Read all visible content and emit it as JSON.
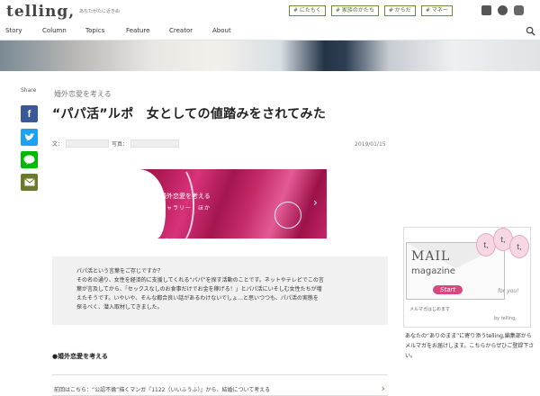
{
  "header": {
    "logo": "telling,",
    "tagline": "あなたがたに近きぬ",
    "tags": [
      "# にたもく",
      "# 家族のかたち",
      "# からだ",
      "# マネー"
    ]
  },
  "nav": {
    "items": [
      "Story",
      "Column",
      "Topics",
      "Feature",
      "Creator",
      "About"
    ]
  },
  "share": {
    "label": "Share",
    "icons": [
      "facebook-icon",
      "twitter-icon",
      "line-icon",
      "mail-icon"
    ]
  },
  "article": {
    "category": "婚外恋愛を考える",
    "title": "“パパ活”ルポ　女としての値踏みをされてみた",
    "writer_label": "文：",
    "photo_label": "写真：",
    "date": "2019/01/15",
    "banner": {
      "line1": "婚外恋愛を考える",
      "line2": "ギャラリー　ほか",
      "arrow": "›"
    },
    "summary": [
      "パパ活という言葉をご存じですか？",
      "その名の通り、女性を経済的に支援してくれる“パパ”を探す活動のことです。ネットやテレビでこの言",
      "葉が言及してから、「セックスなしのお食事だけでお金を稼げる！」とパパ活にいそしむ女性たちが増",
      "えたそうです。いやいや、そんな都合良い話があるわけないでしょ…と思いつつも、パパ活の実態を",
      "探るべく、潜入取材してきました。"
    ],
    "section_heading": "●婚外恋愛を考える",
    "related": {
      "text": "前回はこちら：“公認不倫”描くマンガ『1122（いいふうふ）』から、結婚について考える",
      "arrow": "›"
    }
  },
  "sidebar": {
    "mail": {
      "balloons": [
        "t,",
        "t,",
        "t,"
      ],
      "title": "MAIL",
      "subtitle": "magazine",
      "start": "Start",
      "for_you": "for you!",
      "sub": "メルマガはじめます",
      "by": "by telling,",
      "description": "あなたの“ありのまま”に寄り添うtelling,編集部からメルマガをお届けします。こちらからぜひご登録下さい。"
    }
  },
  "colors": {
    "accent_green": "#6a8b3a",
    "banner_pink": "#c42a69",
    "facebook": "#3b5998",
    "twitter": "#1da1f2",
    "line": "#00b900",
    "mail": "#6b7a2a"
  }
}
